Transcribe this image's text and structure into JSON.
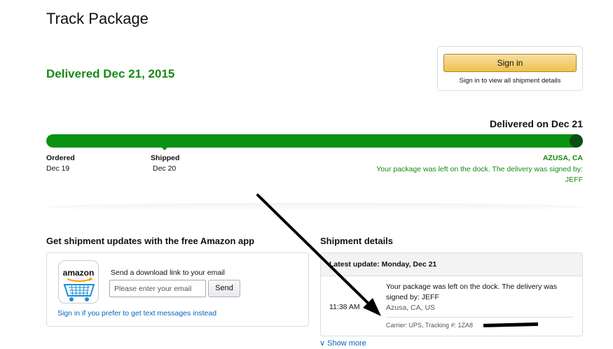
{
  "page": {
    "title": "Track Package",
    "delivered_headline": "Delivered Dec 21, 2015"
  },
  "signin": {
    "button_label": "Sign in",
    "subtext": "Sign in to view all shipment details"
  },
  "progress": {
    "status_label": "Delivered on Dec 21",
    "fraction_complete": 1.0,
    "milestones": [
      {
        "label": "Ordered",
        "date": "Dec 19"
      },
      {
        "label": "Shipped",
        "date": "Dec 20"
      }
    ],
    "location": "AZUSA, CA",
    "message_line1": "Your package was left on the dock. The delivery was signed by:",
    "message_line2": "JEFF"
  },
  "app_promo": {
    "heading": "Get shipment updates with the free Amazon app",
    "icon_text": "amazon",
    "send_label": "Send a download link to your email",
    "email_placeholder": "Please enter your email",
    "send_button": "Send",
    "text_link": "Sign in if you prefer to get text messages instead"
  },
  "shipment": {
    "heading": "Shipment details",
    "latest_update": "Latest update: Monday, Dec 21",
    "event_time": "11:38 AM",
    "event_message": "Your package was left on the dock. The delivery was signed by: JEFF",
    "event_location": "Azusa, CA, US",
    "carrier_info": "Carrier: UPS, Tracking #: 1ZA8",
    "show_more": "Show more"
  },
  "colors": {
    "delivered_green": "#178a14",
    "progress_green": "#0a9212",
    "progress_end": "#0b4e12",
    "link_blue": "#0066c0",
    "signin_yellow": "#f0c14b"
  }
}
